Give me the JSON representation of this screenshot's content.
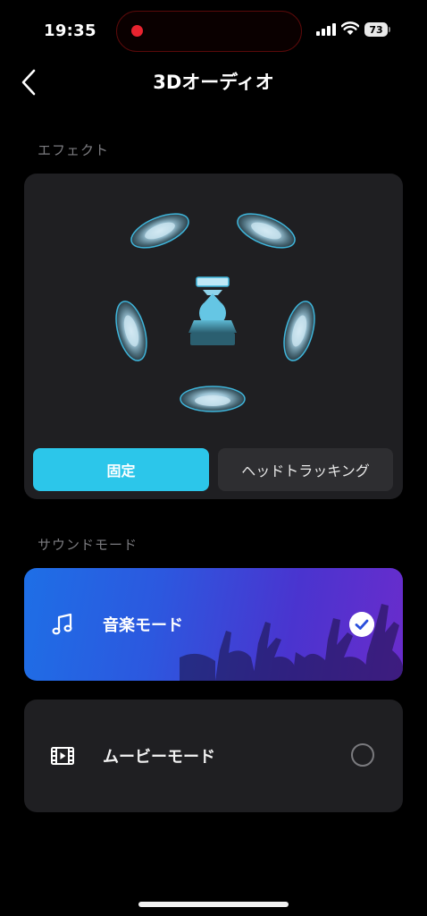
{
  "status_bar": {
    "time": "19:35",
    "battery": "73",
    "recording_color": "#e8232f"
  },
  "nav": {
    "back_icon": "chevron-left-icon",
    "title": "3Dオーディオ"
  },
  "effect": {
    "section_label": "エフェクト",
    "buttons": [
      {
        "label": "固定",
        "selected": true
      },
      {
        "label": "ヘッドトラッキング",
        "selected": false
      }
    ],
    "accent_color": "#2cc6ea"
  },
  "sound_mode": {
    "section_label": "サウンドモード",
    "modes": [
      {
        "label": "音楽モード",
        "icon": "music-note-icon",
        "selected": true
      },
      {
        "label": "ムービーモード",
        "icon": "film-icon",
        "selected": false
      }
    ]
  }
}
